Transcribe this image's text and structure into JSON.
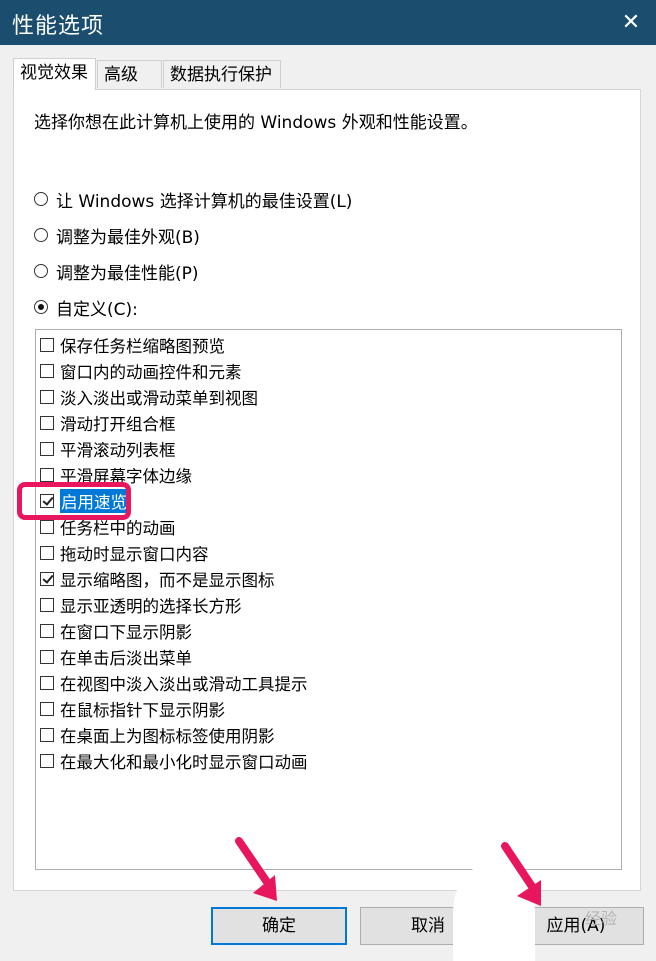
{
  "window": {
    "title": "性能选项",
    "close_glyph": "✕"
  },
  "tabs": [
    {
      "label": "视觉效果",
      "active": true
    },
    {
      "label": "高级",
      "active": false
    },
    {
      "label": "数据执行保护",
      "active": false
    }
  ],
  "intro": "选择你想在此计算机上使用的 Windows 外观和性能设置。",
  "radios": [
    {
      "label": "让 Windows 选择计算机的最佳设置(L)",
      "checked": false
    },
    {
      "label": "调整为最佳外观(B)",
      "checked": false
    },
    {
      "label": "调整为最佳性能(P)",
      "checked": false
    },
    {
      "label": "自定义(C):",
      "checked": true
    }
  ],
  "options": [
    {
      "label": "保存任务栏缩略图预览",
      "checked": false
    },
    {
      "label": "窗口内的动画控件和元素",
      "checked": false
    },
    {
      "label": "淡入淡出或滑动菜单到视图",
      "checked": false
    },
    {
      "label": "滑动打开组合框",
      "checked": false
    },
    {
      "label": "平滑滚动列表框",
      "checked": false
    },
    {
      "label": "平滑屏幕字体边缘",
      "checked": false
    },
    {
      "label": "启用速览",
      "checked": true,
      "selected": true
    },
    {
      "label": "任务栏中的动画",
      "checked": false
    },
    {
      "label": "拖动时显示窗口内容",
      "checked": false
    },
    {
      "label": "显示缩略图，而不是显示图标",
      "checked": true
    },
    {
      "label": "显示亚透明的选择长方形",
      "checked": false
    },
    {
      "label": "在窗口下显示阴影",
      "checked": false
    },
    {
      "label": "在单击后淡出菜单",
      "checked": false
    },
    {
      "label": "在视图中淡入淡出或滑动工具提示",
      "checked": false
    },
    {
      "label": "在鼠标指针下显示阴影",
      "checked": false
    },
    {
      "label": "在桌面上为图标标签使用阴影",
      "checked": false
    },
    {
      "label": "在最大化和最小化时显示窗口动画",
      "checked": false
    }
  ],
  "buttons": {
    "ok": "确定",
    "cancel": "取消",
    "apply": "应用(A)"
  },
  "watermark": "经验",
  "colors": {
    "titlebar": "#1a4d6e",
    "annotation": "#e8175d",
    "selection": "#0078d7"
  }
}
